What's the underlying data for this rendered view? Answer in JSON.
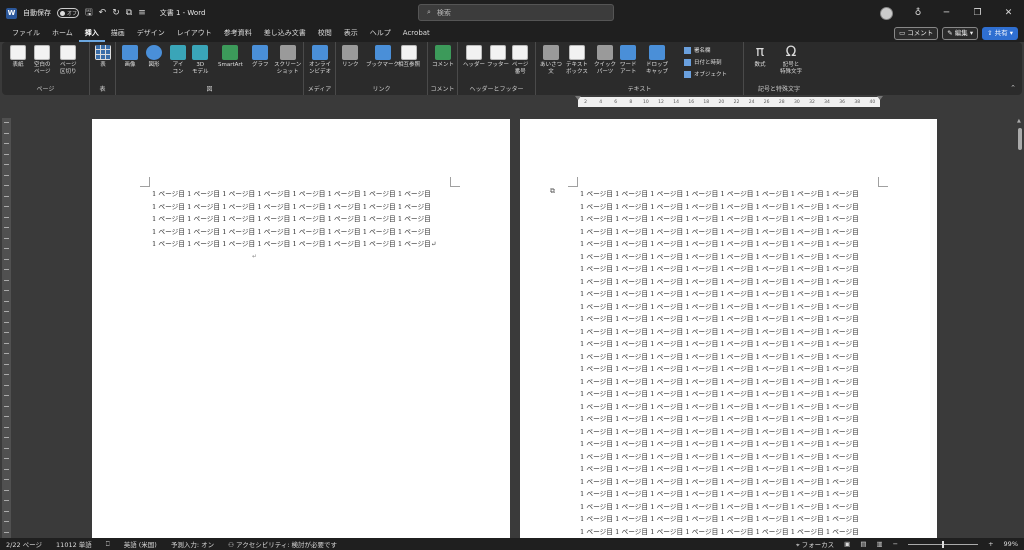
{
  "titlebar": {
    "autosave_label": "自動保存",
    "autosave_state": "オフ",
    "doc_title": "文書 1  -  Word",
    "search_placeholder": "検索"
  },
  "menu": {
    "tabs": [
      "ファイル",
      "ホーム",
      "挿入",
      "描画",
      "デザイン",
      "レイアウト",
      "参考資料",
      "差し込み文書",
      "校閲",
      "表示",
      "ヘルプ",
      "Acrobat"
    ],
    "active_tab": "挿入",
    "comment_btn": "コメント",
    "edit_btn": "編集",
    "share_btn": "共有"
  },
  "ribbon": {
    "groups": {
      "pages": "ページ",
      "table": "表",
      "illustrations": "図",
      "media": "メディア",
      "links": "リンク",
      "comments": "コメント",
      "header_footer": "ヘッダーとフッター",
      "text": "テキスト",
      "symbols": "記号と特殊文字"
    },
    "buttons": {
      "cover": "表紙",
      "blank_page_1": "空白の",
      "blank_page_2": "ページ",
      "page_break_1": "ページ",
      "page_break_2": "区切り",
      "table": "表",
      "picture": "画像",
      "shapes": "図形",
      "icons_1": "アイ",
      "icons_2": "コン",
      "models_1": "3D",
      "models_2": "モデル",
      "smartart": "SmartArt",
      "chart": "グラフ",
      "screenshot_1": "スクリーン",
      "screenshot_2": "ショット",
      "online_video_1": "オンライ",
      "online_video_2": "ンビデオ",
      "link": "リンク",
      "bookmark": "ブックマーク",
      "cross_ref": "相互参照",
      "comment": "コメント",
      "header": "ヘッダー",
      "footer": "フッター",
      "page_number_1": "ページ",
      "page_number_2": "番号",
      "greeting_1": "あいさつ",
      "greeting_2": "文",
      "textbox_1": "テキスト",
      "textbox_2": "ボックス",
      "quickparts_1": "クイック",
      "quickparts_2": "パーツ",
      "wordart_1": "ワード",
      "wordart_2": "アート",
      "dropcap_1": "ドロップ",
      "dropcap_2": "キャップ",
      "signature": "署名欄",
      "datetime": "日付と時刻",
      "object": "オブジェクト",
      "equation": "数式",
      "symbol_1": "記号と",
      "symbol_2": "特殊文字"
    }
  },
  "ruler_numbers": [
    "2",
    "4",
    "6",
    "8",
    "10",
    "12",
    "14",
    "16",
    "18",
    "20",
    "22",
    "24",
    "26",
    "28",
    "30",
    "32",
    "34",
    "36",
    "38",
    "40"
  ],
  "page1": {
    "lines": [
      "1 ページ目 1 ページ目 1 ページ目 1 ページ目 1 ページ目 1 ページ目 1 ページ目 1 ページ目",
      "1 ページ目 1 ページ目 1 ページ目 1 ページ目 1 ページ目 1 ページ目 1 ページ目 1 ページ目",
      "1 ページ目 1 ページ目 1 ページ目 1 ページ目 1 ページ目 1 ページ目 1 ページ目 1 ページ目",
      "1 ページ目 1 ページ目 1 ページ目 1 ページ目 1 ページ目 1 ページ目 1 ページ目 1 ページ目",
      "1 ページ目 1 ページ目 1 ページ目 1 ページ目 1 ページ目 1 ページ目 1 ページ目 1 ページ目↵"
    ],
    "end_mark": "↵"
  },
  "page2": {
    "line_text": "1 ページ目 1 ページ目 1 ページ目 1 ページ目 1 ページ目 1 ページ目 1 ページ目 1 ページ目",
    "line_count": 28
  },
  "status": {
    "page": "2/22 ページ",
    "words": "11012 単語",
    "language": "英語 (米国)",
    "predictive": "予測入力: オン",
    "accessibility": "アクセシビリティ: 検討が必要です",
    "focus": "フォーカス",
    "zoom": "99%"
  },
  "colors": {
    "accent": "#2f6fd1",
    "background": "#3a3a3a",
    "titlebar": "#1f1f1f"
  }
}
